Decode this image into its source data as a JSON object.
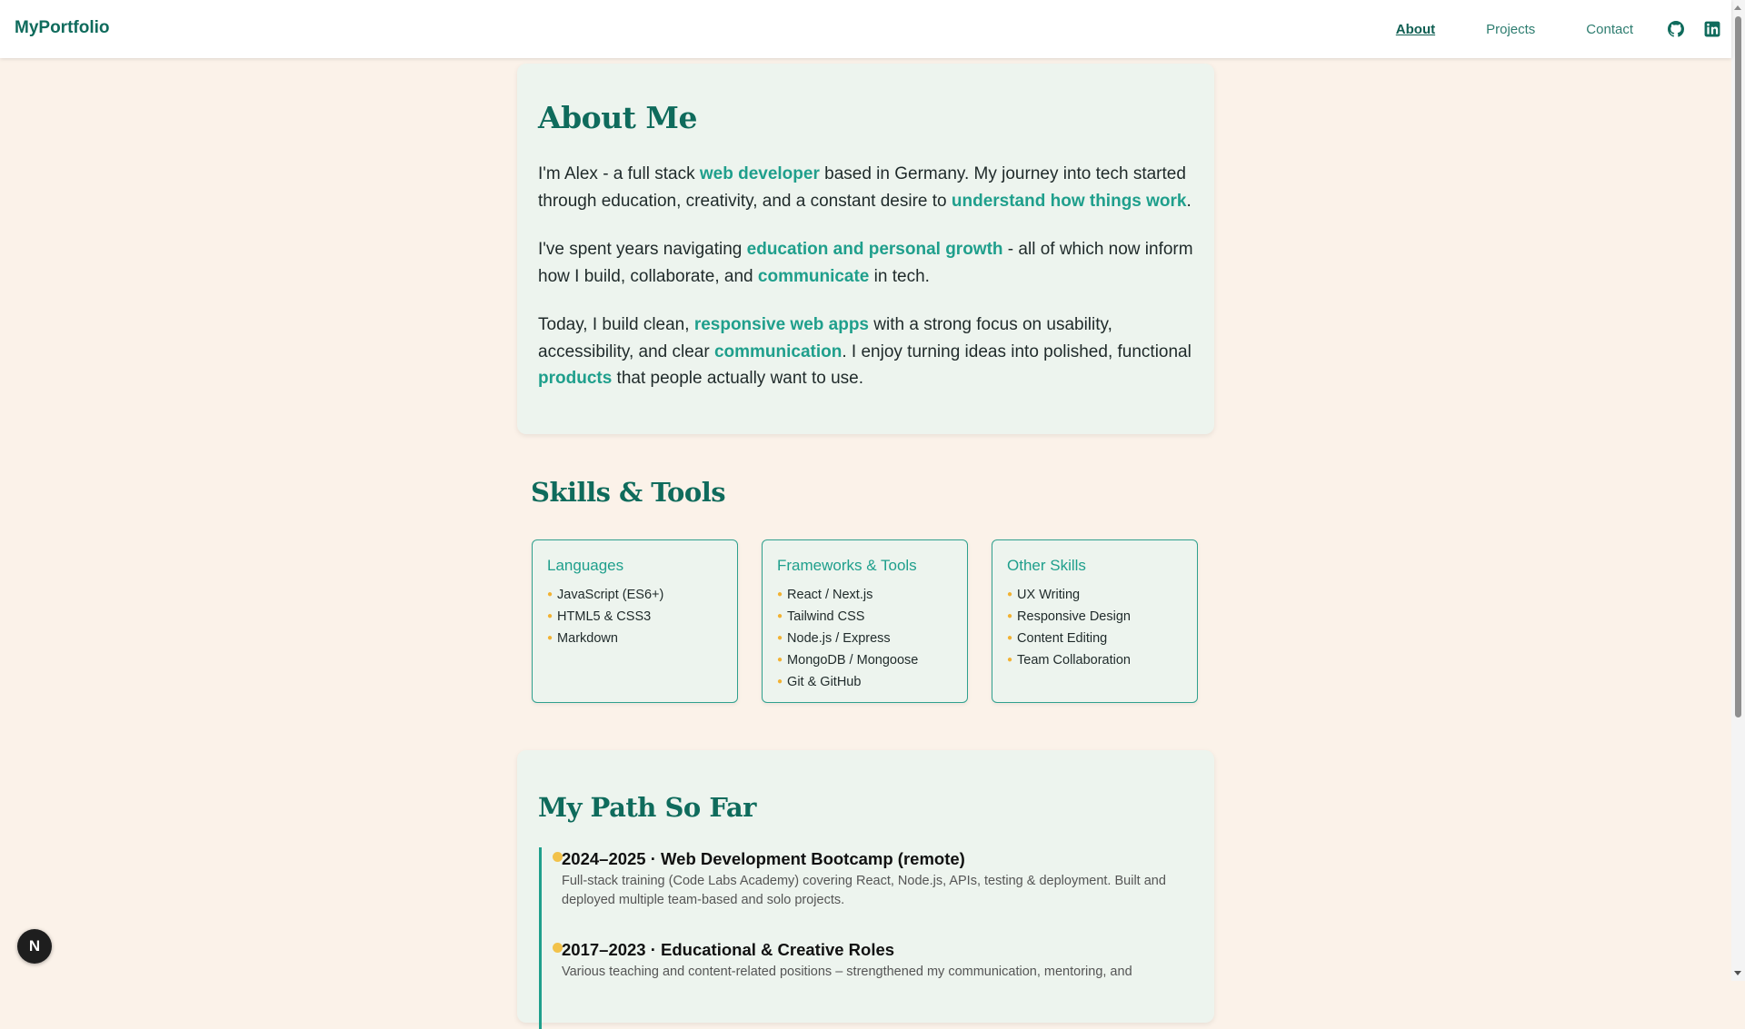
{
  "nav": {
    "logo": "MyPortfolio",
    "links": [
      {
        "label": "About",
        "active": true
      },
      {
        "label": "Projects",
        "active": false
      },
      {
        "label": "Contact",
        "active": false
      }
    ],
    "icons": [
      "github-icon",
      "linkedin-icon"
    ]
  },
  "about": {
    "title": "About Me",
    "p1": [
      "I'm Alex - a full stack ",
      "web developer",
      " based in Germany. My journey into tech started through education, creativity, and a constant desire to ",
      "understand how things work",
      "."
    ],
    "p2": [
      "I've spent years navigating ",
      "education and personal growth",
      " - all of which now inform how I build, collaborate, and ",
      "communicate",
      " in tech."
    ],
    "p3": [
      "Today, I build clean, ",
      "responsive web apps",
      " with a strong focus on usability, accessibility, and clear ",
      "communication",
      ". I enjoy turning ideas into polished, functional ",
      "products",
      " that people actually want to use."
    ]
  },
  "skills": {
    "title": "Skills & Tools",
    "groups": [
      {
        "name": "Languages",
        "items": [
          "JavaScript (ES6+)",
          "HTML5 & CSS3",
          "Markdown"
        ]
      },
      {
        "name": "Frameworks & Tools",
        "items": [
          "React / Next.js",
          "Tailwind CSS",
          "Node.js / Express",
          "MongoDB / Mongoose",
          "Git & GitHub"
        ]
      },
      {
        "name": "Other Skills",
        "items": [
          "UX Writing",
          "Responsive Design",
          "Content Editing",
          "Team Collaboration"
        ]
      }
    ]
  },
  "path": {
    "title": "My Path So Far",
    "entries": [
      {
        "title": "2024–2025 · Web Development Bootcamp (remote)",
        "desc": "Full-stack training (Code Labs Academy) covering React, Node.js, APIs, testing & deployment. Built and deployed multiple team-based and solo projects."
      },
      {
        "title": "2017–2023 · Educational & Creative Roles",
        "desc": "Various teaching and content-related positions – strengthened my communication, mentoring, and"
      }
    ]
  },
  "badge": {
    "label": "N"
  },
  "colors": {
    "brand": "#0f6b5c",
    "highlight": "#1f9f8c",
    "accent_dot": "#f2b233",
    "background": "#fbf2e9",
    "card": "#edf4ee"
  }
}
